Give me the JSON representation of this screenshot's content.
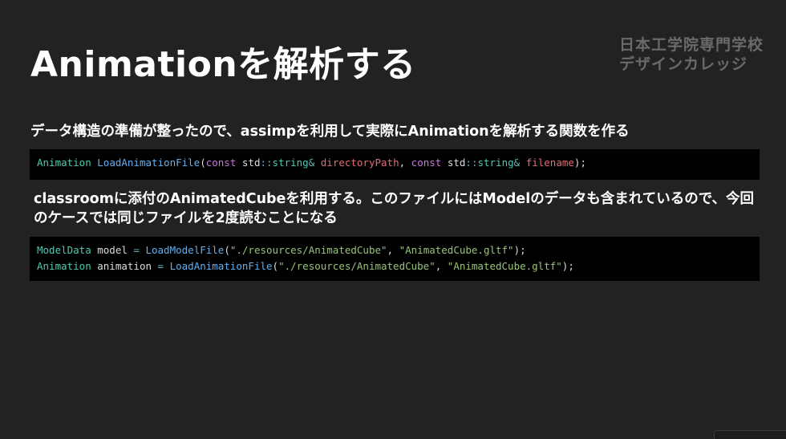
{
  "slide": {
    "title": "Animationを解析する",
    "logo_line1": "日本工学院専門学校",
    "logo_line2": "デザインカレッジ",
    "paragraph1": "データ構造の準備が整ったので、assimpを利用して実際にAnimationを解析する関数を作る",
    "paragraph2": "classroomに添付のAnimatedCubeを利用する。このファイルにはModelのデータも含まれているので、今回のケースでは同じファイルを2度読むことになる"
  },
  "code1": {
    "t1": "Animation",
    "t2": " ",
    "t3": "LoadAnimationFile",
    "t4": "(",
    "t5": "const",
    "t6": " std",
    "t7": "::",
    "t8": "string",
    "t9": "&",
    "t10": " ",
    "t11": "directoryPath",
    "t12": ", ",
    "t13": "const",
    "t14": " std",
    "t15": "::",
    "t16": "string",
    "t17": "&",
    "t18": " ",
    "t19": "filename",
    "t20": ");"
  },
  "code2": {
    "line1": {
      "t1": "ModelData",
      "t2": " model ",
      "t3": "=",
      "t4": " ",
      "t5": "LoadModelFile",
      "t6": "(",
      "t7": "\"./resources/AnimatedCube\"",
      "t8": ", ",
      "t9": "\"AnimatedCube.gltf\"",
      "t10": ");"
    },
    "line2": {
      "t1": "Animation",
      "t2": " animation ",
      "t3": "=",
      "t4": " ",
      "t5": "LoadAnimationFile",
      "t6": "(",
      "t7": "\"./resources/AnimatedCube\"",
      "t8": ", ",
      "t9": "\"AnimatedCube.gltf\"",
      "t10": ");"
    }
  },
  "colors": {
    "background": "#222222",
    "code_background": "#000000",
    "type": "#4ec9b0",
    "function": "#61afef",
    "keyword": "#c678dd",
    "parameter": "#e06c75",
    "string": "#98c379"
  }
}
